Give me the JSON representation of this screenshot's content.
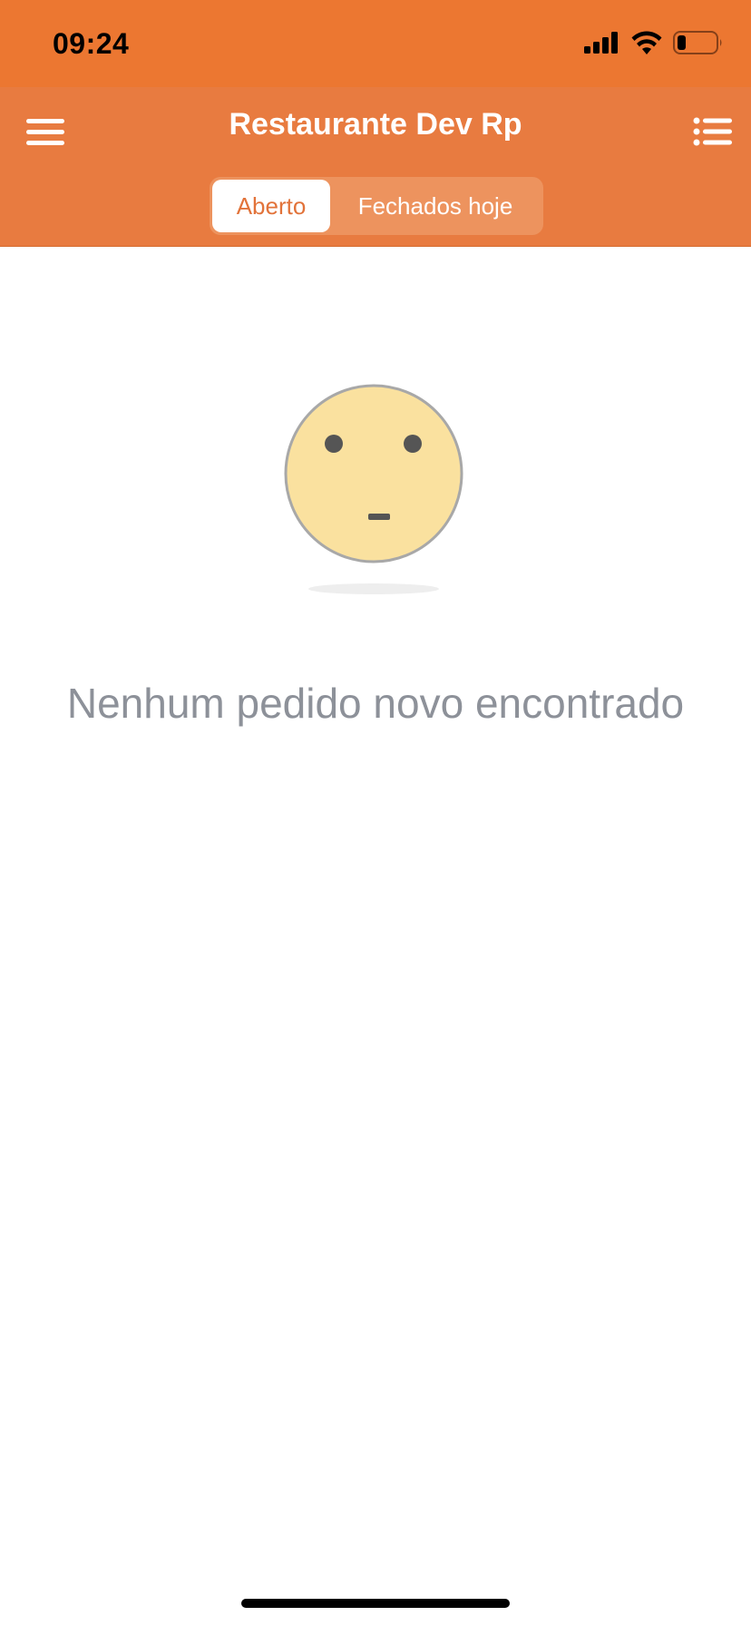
{
  "status_bar": {
    "time": "09:24",
    "icons": [
      "signal-icon",
      "wifi-icon",
      "battery-icon"
    ]
  },
  "header": {
    "title": "Restaurante Dev Rp",
    "left_icon": "menu-icon",
    "right_icon": "list-icon"
  },
  "tabs": [
    {
      "label": "Aberto",
      "selected": true
    },
    {
      "label": "Fechados hoje",
      "selected": false
    }
  ],
  "empty_state": {
    "icon": "neutral-face-icon",
    "message": "Nenhum pedido novo encontrado"
  },
  "colors": {
    "status_bar_bg": "#ec7731",
    "header_bg": "#e87b40",
    "accent": "#e2733a",
    "face_fill": "#fae19f",
    "message_text": "#8d9199"
  }
}
